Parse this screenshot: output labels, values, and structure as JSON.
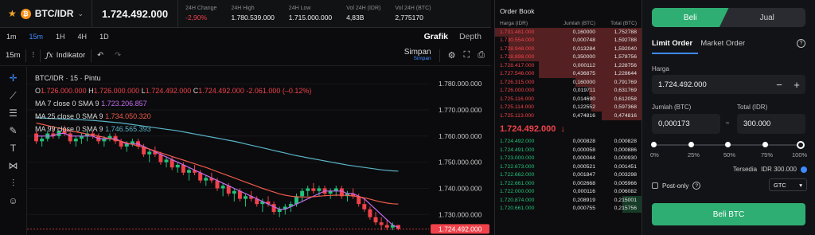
{
  "header": {
    "pair": "BTC/IDR",
    "last_price": "1.724.492.000",
    "stats": [
      {
        "label": "24H Change",
        "value": "-2,90%",
        "neg": true
      },
      {
        "label": "24H High",
        "value": "1.780.539.000",
        "neg": false
      },
      {
        "label": "24H Low",
        "value": "1.715.000.000",
        "neg": false
      },
      {
        "label": "Vol 24H (IDR)",
        "value": "4,83B",
        "neg": false
      },
      {
        "label": "Vol 24H (BTC)",
        "value": "2,775170",
        "neg": false
      }
    ]
  },
  "timeframes": [
    "1m",
    "15m",
    "1H",
    "4H",
    "1D"
  ],
  "active_timeframe": "15m",
  "view_tabs": {
    "grafik": "Grafik",
    "depth": "Depth"
  },
  "toolbar": {
    "interval": "15m",
    "indicator": "Indikator",
    "save": "Simpan",
    "save_sub": "Simpan"
  },
  "legend": {
    "symbol": "BTC/IDR · 15 · Pintu",
    "ohlc": {
      "o_label": "O",
      "o": "1.726.000.000",
      "h_label": "H",
      "h": "1.726.000.000",
      "l_label": "L",
      "l": "1.724.492.000",
      "c_label": "C",
      "c": "1.724.492.000",
      "chg": "-2.061.000 (–0.12%)"
    },
    "ma7": {
      "label": "MA 7 close 0 SMA 9",
      "value": "1.723.206.857"
    },
    "ma25": {
      "label": "MA 25 close 0 SMA 9",
      "value": "1.734.050.320"
    },
    "ma99": {
      "label": "MA 99 close 0 SMA 9",
      "value": "1.746.565.393"
    }
  },
  "chart_data": {
    "type": "line",
    "y_ticks": [
      "1.780.000.000",
      "1.770.000.000",
      "1.760.000.000",
      "1.750.000.000",
      "1.740.000.000",
      "1.730.000.000"
    ],
    "y_tick_values": [
      1780000000,
      1770000000,
      1760000000,
      1750000000,
      1740000000,
      1730000000
    ],
    "ylim": [
      1724000000,
      1784000000
    ],
    "last_price_tag": "1.724.492.000",
    "candles": [
      [
        1761,
        1762,
        1757,
        1758
      ],
      [
        1758,
        1760,
        1756,
        1759
      ],
      [
        1759,
        1762,
        1758,
        1761
      ],
      [
        1761,
        1763,
        1759,
        1760
      ],
      [
        1760,
        1762,
        1759,
        1762
      ],
      [
        1762,
        1764,
        1760,
        1761
      ],
      [
        1761,
        1762,
        1757,
        1758
      ],
      [
        1758,
        1760,
        1756,
        1759
      ],
      [
        1759,
        1761,
        1757,
        1760
      ],
      [
        1760,
        1762,
        1758,
        1761
      ],
      [
        1761,
        1762,
        1759,
        1760
      ],
      [
        1760,
        1761,
        1757,
        1758
      ],
      [
        1758,
        1760,
        1756,
        1759
      ],
      [
        1759,
        1761,
        1758,
        1760
      ],
      [
        1760,
        1761,
        1757,
        1758
      ],
      [
        1758,
        1759,
        1755,
        1756
      ],
      [
        1756,
        1758,
        1754,
        1757
      ],
      [
        1757,
        1759,
        1756,
        1758
      ],
      [
        1758,
        1759,
        1755,
        1756
      ],
      [
        1756,
        1757,
        1752,
        1753
      ],
      [
        1753,
        1755,
        1750,
        1754
      ],
      [
        1754,
        1756,
        1752,
        1753
      ],
      [
        1753,
        1754,
        1749,
        1750
      ],
      [
        1750,
        1752,
        1748,
        1751
      ],
      [
        1751,
        1752,
        1747,
        1748
      ],
      [
        1748,
        1750,
        1746,
        1749
      ],
      [
        1749,
        1750,
        1745,
        1746
      ],
      [
        1746,
        1748,
        1743,
        1747
      ],
      [
        1747,
        1749,
        1745,
        1746
      ],
      [
        1746,
        1747,
        1742,
        1743
      ],
      [
        1743,
        1745,
        1741,
        1744
      ],
      [
        1744,
        1746,
        1742,
        1743
      ],
      [
        1743,
        1744,
        1739,
        1740
      ],
      [
        1740,
        1742,
        1737,
        1741
      ],
      [
        1741,
        1742,
        1737,
        1738
      ],
      [
        1738,
        1740,
        1735,
        1739
      ],
      [
        1739,
        1740,
        1735,
        1736
      ],
      [
        1736,
        1738,
        1733,
        1737
      ],
      [
        1737,
        1739,
        1735,
        1736
      ],
      [
        1736,
        1737,
        1733,
        1734
      ],
      [
        1734,
        1736,
        1731,
        1735
      ],
      [
        1735,
        1737,
        1733,
        1734
      ],
      [
        1734,
        1735,
        1730,
        1731
      ],
      [
        1731,
        1733,
        1729,
        1732
      ],
      [
        1732,
        1734,
        1730,
        1733
      ],
      [
        1733,
        1735,
        1731,
        1734
      ],
      [
        1734,
        1738,
        1733,
        1737
      ],
      [
        1737,
        1740,
        1735,
        1739
      ],
      [
        1739,
        1741,
        1737,
        1740
      ],
      [
        1740,
        1742,
        1738,
        1739
      ],
      [
        1739,
        1741,
        1737,
        1740
      ],
      [
        1740,
        1741,
        1737,
        1738
      ],
      [
        1738,
        1740,
        1736,
        1739
      ],
      [
        1739,
        1741,
        1737,
        1740
      ],
      [
        1740,
        1741,
        1736,
        1737
      ],
      [
        1737,
        1739,
        1735,
        1738
      ],
      [
        1738,
        1740,
        1736,
        1737
      ],
      [
        1737,
        1738,
        1733,
        1734
      ],
      [
        1734,
        1736,
        1731,
        1732
      ],
      [
        1732,
        1733,
        1728,
        1729
      ],
      [
        1729,
        1731,
        1726,
        1727
      ],
      [
        1727,
        1729,
        1724,
        1726
      ],
      [
        1726,
        1728,
        1724,
        1725
      ],
      [
        1725,
        1727,
        1724,
        1726
      ],
      [
        1726,
        1726,
        1724,
        1724.5
      ]
    ],
    "series": [
      {
        "name": "MA 7 close 0 SMA 9",
        "color": "#c46cf0",
        "values": [
          1760,
          1760,
          1760,
          1760,
          1761,
          1761,
          1760,
          1760,
          1760,
          1760,
          1760,
          1759,
          1759,
          1759,
          1759,
          1758,
          1757,
          1757,
          1757,
          1756,
          1755,
          1754,
          1753,
          1752,
          1751,
          1750,
          1749,
          1748,
          1747,
          1746,
          1745,
          1744,
          1743,
          1742,
          1741,
          1740,
          1739,
          1738,
          1737,
          1736,
          1735,
          1734,
          1733,
          1732,
          1732,
          1733,
          1734,
          1735,
          1736,
          1737,
          1738,
          1739,
          1739,
          1739,
          1739,
          1738,
          1738,
          1737,
          1736,
          1734,
          1732,
          1730,
          1728,
          1726,
          1725
        ]
      },
      {
        "name": "MA 25 close 0 SMA 9",
        "color": "#f05a4a",
        "values": [
          1765,
          1764.5,
          1764,
          1763.5,
          1763,
          1762.5,
          1762,
          1761.6,
          1761.2,
          1760.8,
          1760.4,
          1760,
          1759.5,
          1759,
          1758.5,
          1758,
          1757.4,
          1756.8,
          1756.2,
          1755.6,
          1755,
          1754.3,
          1753.6,
          1752.9,
          1752.2,
          1751.5,
          1750.8,
          1750.1,
          1749.4,
          1748.7,
          1748,
          1747.2,
          1746.4,
          1745.6,
          1744.8,
          1744,
          1743.2,
          1742.4,
          1741.6,
          1740.8,
          1740,
          1739.3,
          1738.6,
          1737.9,
          1737.4,
          1737,
          1736.8,
          1736.7,
          1736.7,
          1736.8,
          1737,
          1737.2,
          1737.3,
          1737.4,
          1737.4,
          1737.3,
          1737.1,
          1736.8,
          1736.4,
          1735.9,
          1735.3,
          1734.8,
          1734.4,
          1734.1,
          1734
        ]
      },
      {
        "name": "MA 99 close 0 SMA 9",
        "color": "#5ab4c8",
        "values": [
          1767,
          1766.9,
          1766.8,
          1766.7,
          1766.6,
          1766.5,
          1766.4,
          1766.3,
          1766.2,
          1766.1,
          1766,
          1765.8,
          1765.6,
          1765.4,
          1765.2,
          1765,
          1764.7,
          1764.4,
          1764.1,
          1763.8,
          1763.5,
          1763.2,
          1762.9,
          1762.6,
          1762.3,
          1762,
          1761.6,
          1761.2,
          1760.8,
          1760.4,
          1760,
          1759.6,
          1759.2,
          1758.8,
          1758.4,
          1758,
          1757.5,
          1757,
          1756.5,
          1756,
          1755.5,
          1755,
          1754.5,
          1754,
          1753.5,
          1753,
          1752.5,
          1752.1,
          1751.7,
          1751.3,
          1750.9,
          1750.5,
          1750.1,
          1749.7,
          1749.3,
          1748.9,
          1748.6,
          1748.3,
          1748,
          1747.7,
          1747.4,
          1747.1,
          1746.9,
          1746.7,
          1746.6
        ]
      }
    ]
  },
  "orderbook": {
    "title": "Order Book",
    "headers": [
      "Harga (IDR)",
      "Jumlah (BTC)",
      "Total (BTC)"
    ],
    "asks": [
      [
        "1.731.481.000",
        "0,160000",
        "1,752788",
        100
      ],
      [
        "1.730.554.000",
        "0,000748",
        "1,592788",
        91
      ],
      [
        "1.728.948.000",
        "0,013284",
        "1,592040",
        91
      ],
      [
        "1.728.898.000",
        "0,350000",
        "1,578756",
        90
      ],
      [
        "1.728.417.000",
        "0,000112",
        "1,228756",
        70
      ],
      [
        "1.727.546.000",
        "0,436875",
        "1,228644",
        70
      ],
      [
        "1.726.315.000",
        "0,160000",
        "0,791769",
        45
      ],
      [
        "1.726.000.000",
        "0,019711",
        "0,631769",
        36
      ],
      [
        "1.725.116.000",
        "0,014690",
        "0,612058",
        35
      ],
      [
        "1.725.114.000",
        "0,122552",
        "0,597368",
        34
      ],
      [
        "1.725.113.000",
        "0,474816",
        "0,474816",
        27
      ]
    ],
    "mid_price": "1.724.492.000",
    "bids": [
      [
        "1.724.492.000",
        "0,000828",
        "0,000828",
        0
      ],
      [
        "1.724.491.000",
        "0,000058",
        "0,000886",
        0
      ],
      [
        "1.723.000.000",
        "0,000044",
        "0,000930",
        0
      ],
      [
        "1.722.673.000",
        "0,000521",
        "0,001451",
        0
      ],
      [
        "1.722.662.000",
        "0,001847",
        "0,003298",
        0
      ],
      [
        "1.722.661.000",
        "0,002668",
        "0,005966",
        0
      ],
      [
        "1.722.000.000",
        "0,000116",
        "0,006082",
        0
      ],
      [
        "1.720.874.000",
        "0,208919",
        "0,215001",
        13
      ],
      [
        "1.720.661.000",
        "0,000755",
        "0,215756",
        13
      ]
    ]
  },
  "trade": {
    "buy_tab": "Beli",
    "sell_tab": "Jual",
    "limit_tab": "Limit Order",
    "market_tab": "Market Order",
    "price_label": "Harga",
    "price_value": "1.724.492.000",
    "amount_label": "Jumlah (BTC)",
    "amount_value": "0,000173",
    "total_label": "Total (IDR)",
    "total_value": "300.000",
    "percents": [
      "0%",
      "25%",
      "50%",
      "75%",
      "100%"
    ],
    "available_label": "Tersedia",
    "available_value": "IDR 300.000",
    "post_only": "Post-only",
    "tif": "GTC",
    "buy_button": "Beli BTC",
    "accent": "#2fae73"
  }
}
